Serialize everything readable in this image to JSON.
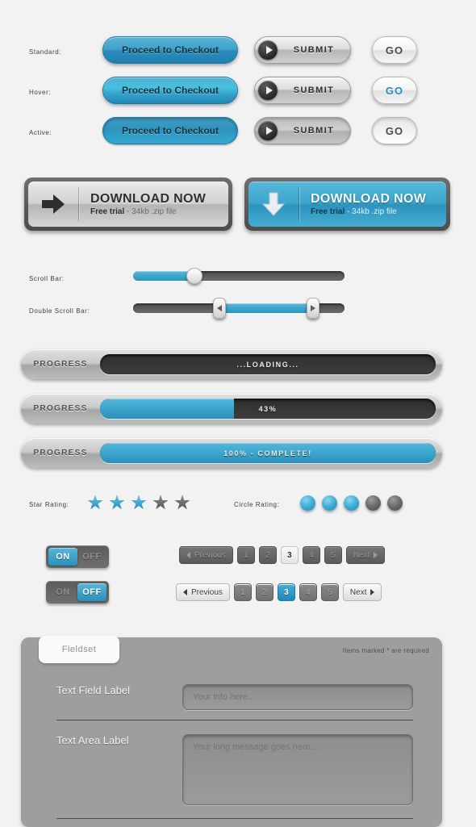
{
  "button_states": {
    "standard_label": "Standard:",
    "hover_label": "Hover:",
    "active_label": "Active:"
  },
  "checkout_buttons": {
    "label": "Proceed to Checkout",
    "accent_color": "#3fa3cc"
  },
  "submit_buttons": {
    "label": "SUBMIT",
    "icon": "play-icon"
  },
  "go_buttons": {
    "label": "GO",
    "hover_text_color": "#1f8ec4"
  },
  "download": {
    "grey": {
      "title": "DOWNLOAD NOW",
      "sub_bold": "Free trial",
      "sub_rest": " - 34kb .zip file",
      "icon": "arrow-right-icon"
    },
    "blue": {
      "title": "DOWNLOAD NOW",
      "sub_bold": "Free trial",
      "sub_rest": " - 34kb .zip file",
      "icon": "arrow-down-icon"
    }
  },
  "sliders": {
    "single": {
      "label": "Scroll Bar:",
      "value_percent": 29
    },
    "double": {
      "label": "Double Scroll Bar:",
      "start_percent": 41,
      "end_percent": 85
    }
  },
  "progress_bars": [
    {
      "label": "PROGRESS",
      "text": "...LOADING...",
      "percent": 0
    },
    {
      "label": "PROGRESS",
      "text": "43%",
      "percent": 40
    },
    {
      "label": "PROGRESS",
      "text": "100% - COMPLETE!",
      "percent": 100
    }
  ],
  "ratings": {
    "star": {
      "label": "Star Rating:",
      "filled": 3,
      "total": 5
    },
    "circle": {
      "label": "Circle Rating:",
      "filled": 3,
      "total": 5
    }
  },
  "toggles": [
    {
      "on_label": "ON",
      "off_label": "OFF",
      "selected": "ON"
    },
    {
      "on_label": "ON",
      "off_label": "OFF",
      "selected": "OFF"
    }
  ],
  "pagination": {
    "previous_label": "Previous",
    "next_label": "Next",
    "pages": [
      "1",
      "2",
      "3",
      "4",
      "5"
    ],
    "current_page": "3"
  },
  "fieldset": {
    "tab_label": "Fieldset",
    "required_note": "Items marked * are required",
    "text_field": {
      "label": "Text Field Label",
      "placeholder": "Your info here..."
    },
    "text_area": {
      "label": "Text Area Label",
      "placeholder": "Your long message goes here..."
    }
  }
}
